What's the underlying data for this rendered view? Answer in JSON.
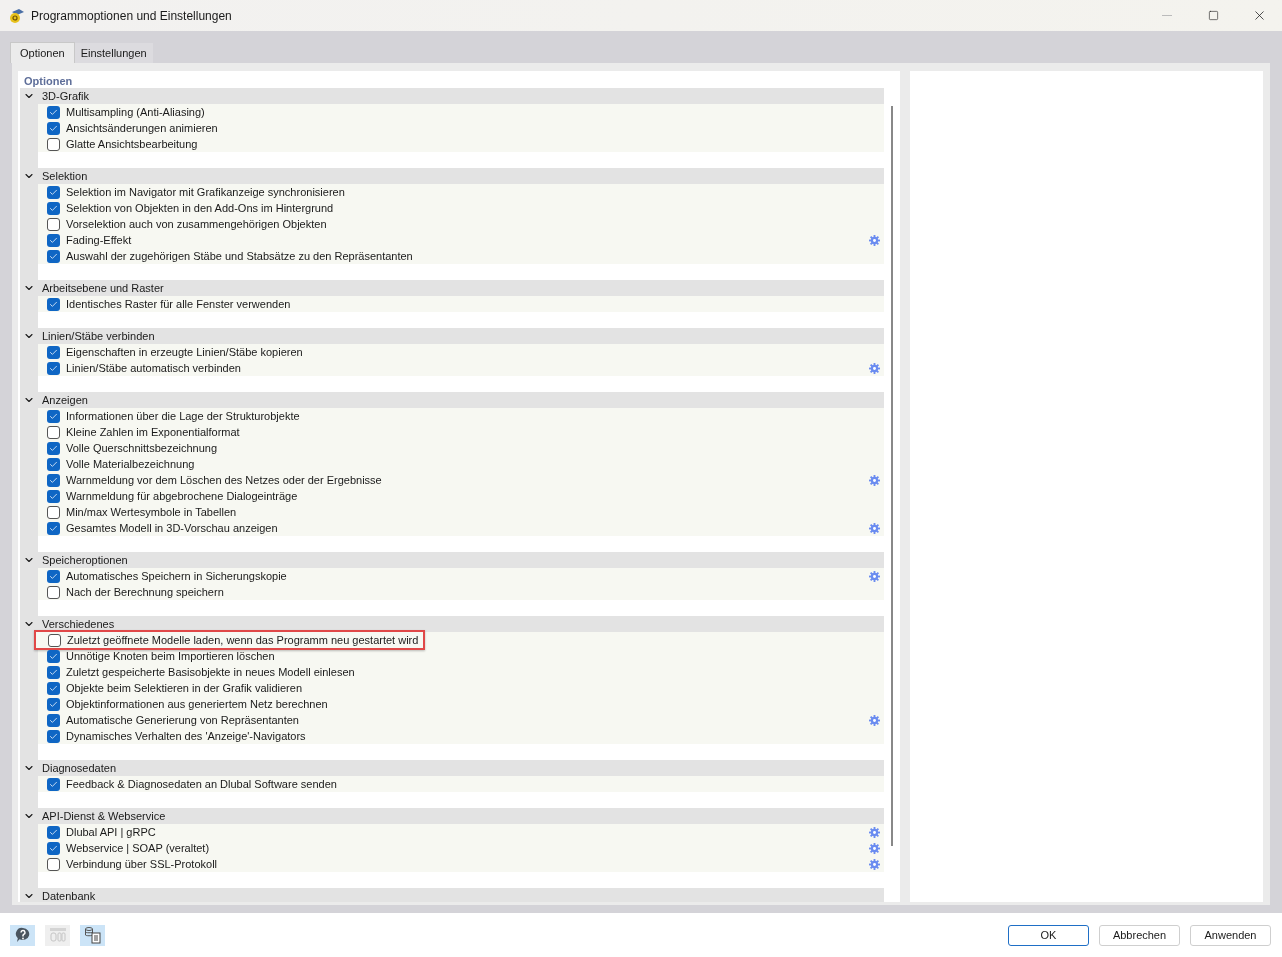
{
  "window": {
    "title": "Programmoptionen und Einstellungen"
  },
  "tabs": [
    {
      "label": "Optionen",
      "selected": true
    },
    {
      "label": "Einstellungen",
      "selected": false
    }
  ],
  "panel_title": "Optionen",
  "sections": [
    {
      "title": "3D-Grafik",
      "expanded": true,
      "items": [
        {
          "label": "Multisampling (Anti-Aliasing)",
          "checked": true,
          "gear": false,
          "highlighted": false
        },
        {
          "label": "Ansichtsänderungen animieren",
          "checked": true,
          "gear": false,
          "highlighted": false
        },
        {
          "label": "Glatte Ansichtsbearbeitung",
          "checked": false,
          "gear": false,
          "highlighted": false
        }
      ]
    },
    {
      "title": "Selektion",
      "expanded": true,
      "items": [
        {
          "label": "Selektion im Navigator mit Grafikanzeige synchronisieren",
          "checked": true,
          "gear": false,
          "highlighted": false
        },
        {
          "label": "Selektion von Objekten in den Add-Ons im Hintergrund",
          "checked": true,
          "gear": false,
          "highlighted": false
        },
        {
          "label": "Vorselektion auch von zusammengehörigen Objekten",
          "checked": false,
          "gear": false,
          "highlighted": false
        },
        {
          "label": "Fading-Effekt",
          "checked": true,
          "gear": true,
          "highlighted": false
        },
        {
          "label": "Auswahl der zugehörigen Stäbe und Stabsätze zu den Repräsentanten",
          "checked": true,
          "gear": false,
          "highlighted": false
        }
      ]
    },
    {
      "title": "Arbeitsebene und Raster",
      "expanded": true,
      "items": [
        {
          "label": "Identisches Raster für alle Fenster verwenden",
          "checked": true,
          "gear": false,
          "highlighted": false
        }
      ]
    },
    {
      "title": "Linien/Stäbe verbinden",
      "expanded": true,
      "items": [
        {
          "label": "Eigenschaften in erzeugte Linien/Stäbe kopieren",
          "checked": true,
          "gear": false,
          "highlighted": false
        },
        {
          "label": "Linien/Stäbe automatisch verbinden",
          "checked": true,
          "gear": true,
          "highlighted": false
        }
      ]
    },
    {
      "title": "Anzeigen",
      "expanded": true,
      "items": [
        {
          "label": "Informationen über die Lage der Strukturobjekte",
          "checked": true,
          "gear": false,
          "highlighted": false
        },
        {
          "label": "Kleine Zahlen im Exponentialformat",
          "checked": false,
          "gear": false,
          "highlighted": false
        },
        {
          "label": "Volle Querschnittsbezeichnung",
          "checked": true,
          "gear": false,
          "highlighted": false
        },
        {
          "label": "Volle Materialbezeichnung",
          "checked": true,
          "gear": false,
          "highlighted": false
        },
        {
          "label": "Warnmeldung vor dem Löschen des Netzes oder der Ergebnisse",
          "checked": true,
          "gear": true,
          "highlighted": false
        },
        {
          "label": "Warnmeldung für abgebrochene Dialogeinträge",
          "checked": true,
          "gear": false,
          "highlighted": false
        },
        {
          "label": "Min/max Wertesymbole in Tabellen",
          "checked": false,
          "gear": false,
          "highlighted": false
        },
        {
          "label": "Gesamtes Modell in 3D-Vorschau anzeigen",
          "checked": true,
          "gear": true,
          "highlighted": false
        }
      ]
    },
    {
      "title": "Speicheroptionen",
      "expanded": true,
      "items": [
        {
          "label": "Automatisches Speichern in Sicherungskopie",
          "checked": true,
          "gear": true,
          "highlighted": false
        },
        {
          "label": "Nach der Berechnung speichern",
          "checked": false,
          "gear": false,
          "highlighted": false
        }
      ]
    },
    {
      "title": "Verschiedenes",
      "expanded": true,
      "items": [
        {
          "label": "Zuletzt geöffnete Modelle laden, wenn das Programm neu gestartet wird",
          "checked": false,
          "gear": false,
          "highlighted": true
        },
        {
          "label": "Unnötige Knoten beim Importieren löschen",
          "checked": true,
          "gear": false,
          "highlighted": false
        },
        {
          "label": "Zuletzt gespeicherte Basisobjekte in neues Modell einlesen",
          "checked": true,
          "gear": false,
          "highlighted": false
        },
        {
          "label": "Objekte beim Selektieren in der Grafik validieren",
          "checked": true,
          "gear": false,
          "highlighted": false
        },
        {
          "label": "Objektinformationen aus generiertem Netz berechnen",
          "checked": true,
          "gear": false,
          "highlighted": false
        },
        {
          "label": "Automatische Generierung von Repräsentanten",
          "checked": true,
          "gear": true,
          "highlighted": false
        },
        {
          "label": "Dynamisches Verhalten des 'Anzeige'-Navigators",
          "checked": true,
          "gear": false,
          "highlighted": false
        }
      ]
    },
    {
      "title": "Diagnosedaten",
      "expanded": true,
      "items": [
        {
          "label": "Feedback & Diagnosedaten an Dlubal Software senden",
          "checked": true,
          "gear": false,
          "highlighted": false
        }
      ]
    },
    {
      "title": "API-Dienst & Webservice",
      "expanded": true,
      "items": [
        {
          "label": "Dlubal API | gRPC",
          "checked": true,
          "gear": true,
          "highlighted": false
        },
        {
          "label": "Webservice | SOAP (veraltet)",
          "checked": true,
          "gear": true,
          "highlighted": false
        },
        {
          "label": "Verbindung über SSL-Protokoll",
          "checked": false,
          "gear": true,
          "highlighted": false
        }
      ]
    },
    {
      "title": "Datenbank",
      "expanded": true
    }
  ],
  "footer_tools": [
    {
      "kind": "help",
      "disabled": false
    },
    {
      "kind": "decimals",
      "disabled": true
    },
    {
      "kind": "database",
      "disabled": false
    }
  ],
  "buttons": [
    {
      "label": "OK",
      "default": true
    },
    {
      "label": "Abbrechen",
      "default": false
    },
    {
      "label": "Anwenden",
      "default": false
    }
  ]
}
